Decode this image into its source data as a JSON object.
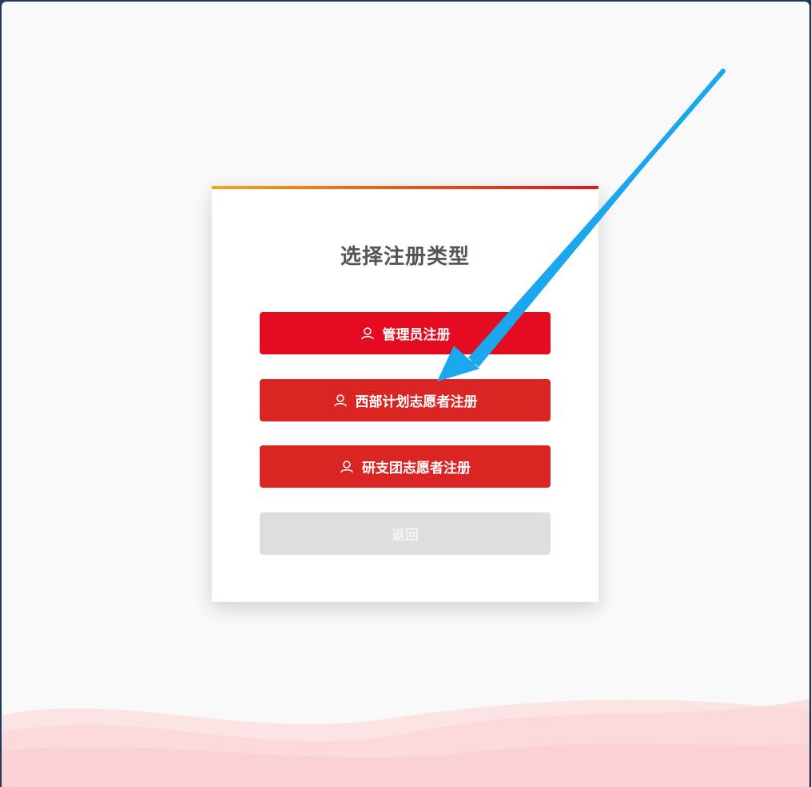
{
  "title": "选择注册类型",
  "buttons": {
    "admin": "管理员注册",
    "west_plan": "西部计划志愿者注册",
    "graduate": "研支团志愿者注册",
    "back": "返回"
  },
  "icons": {
    "user": "user-icon"
  },
  "colors": {
    "primary_red": "#e50b20",
    "secondary_red": "#db2525",
    "back_gray": "#dedede",
    "annotation_arrow": "#1aa7ee"
  }
}
